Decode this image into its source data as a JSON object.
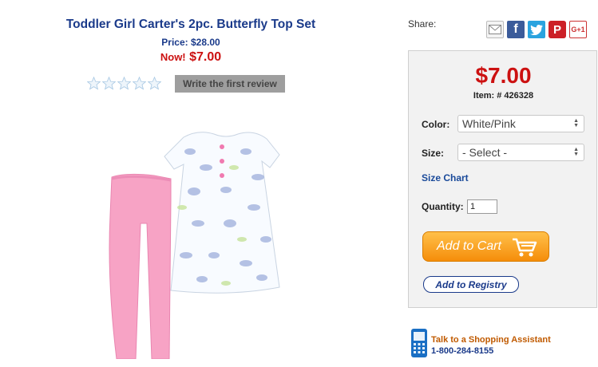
{
  "product": {
    "title": "Toddler Girl Carter's 2pc. Butterfly Top Set",
    "price_label": "Price: $28.00",
    "now_label": "Now!",
    "now_price": "$7.00",
    "rating": {
      "stars_filled": 0,
      "stars_total": 5
    },
    "review_button": "Write the first review",
    "image_alt": "Butterfly print top with pink leggings"
  },
  "share": {
    "label": "Share:",
    "icons": [
      "mail-icon",
      "facebook-icon",
      "twitter-icon",
      "pinterest-icon",
      "google-plus-icon"
    ],
    "google_plus_text": "G+1"
  },
  "buy_box": {
    "price": "$7.00",
    "item_number": "Item: # 426328",
    "color_label": "Color:",
    "color_value": "White/Pink",
    "size_label": "Size:",
    "size_value": "- Select -",
    "size_chart": "Size Chart",
    "quantity_label": "Quantity:",
    "quantity_value": "1",
    "add_to_cart": "Add to Cart",
    "add_to_registry": "Add to Registry"
  },
  "assistant": {
    "title": "Talk to a Shopping Assistant",
    "phone": "1-800-284-8155"
  },
  "colors": {
    "price_red": "#cc1111",
    "title_blue": "#1a3a8a",
    "cart_orange": "#f58d0a",
    "leggings_pink": "#f7a3c5"
  }
}
